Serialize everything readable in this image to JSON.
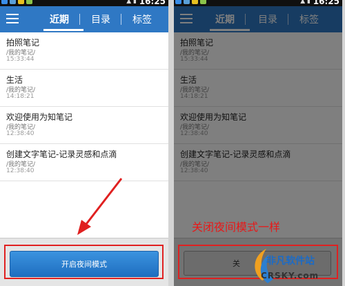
{
  "status": {
    "time": "16:25"
  },
  "tabs": [
    {
      "label": "近期"
    },
    {
      "label": "目录"
    },
    {
      "label": "标签"
    }
  ],
  "notes": [
    {
      "title": "拍照笔记",
      "path": "/我的笔记/",
      "time": "15:33:44"
    },
    {
      "title": "生活",
      "path": "/我的笔记/",
      "time": "14:18:21"
    },
    {
      "title": "欢迎使用为知笔记",
      "path": "/我的笔记/",
      "time": "12:38:40"
    },
    {
      "title": "创建文字笔记-记录灵感和点滴",
      "path": "/我的笔记/",
      "time": "12:38:40"
    }
  ],
  "left": {
    "night_button_label": "开启夜间模式"
  },
  "right": {
    "night_button_label_visible": "关"
  },
  "annotation": {
    "caption": "关闭夜间模式一样",
    "color": "#e81818"
  },
  "watermark": {
    "brand": "非凡软件站",
    "site": "CRSKY.com"
  },
  "colors": {
    "appbar": "#2f78c4",
    "accent_button": "#2a83d3"
  }
}
